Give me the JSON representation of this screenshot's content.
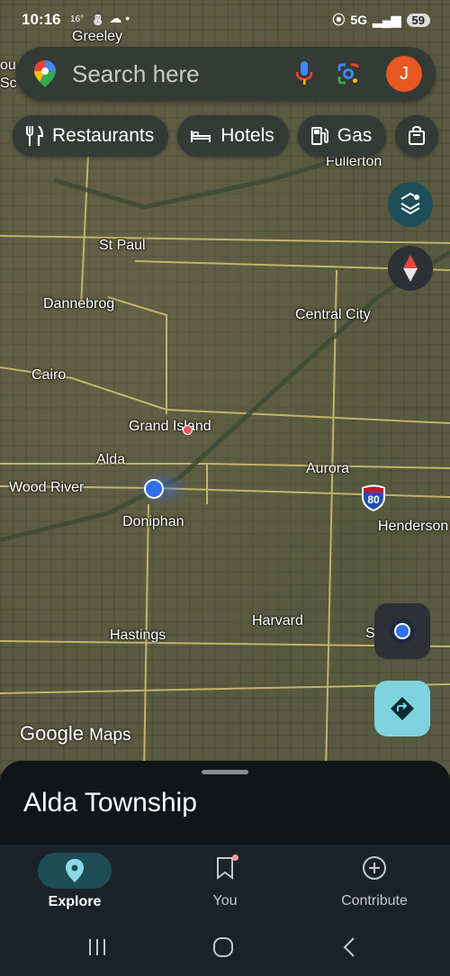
{
  "status_bar": {
    "time": "10:16",
    "temp": "16°",
    "weather": "⛄ ☁ •",
    "network": "5G",
    "battery": "59"
  },
  "search": {
    "placeholder": "Search here",
    "avatar_letter": "J"
  },
  "chips": [
    {
      "label": "Restaurants",
      "icon": "fork-knife-icon"
    },
    {
      "label": "Hotels",
      "icon": "bed-icon"
    },
    {
      "label": "Gas",
      "icon": "gas-pump-icon"
    },
    {
      "label": "",
      "icon": "shopping-bag-icon"
    }
  ],
  "map": {
    "places": [
      {
        "name": "Greeley"
      },
      {
        "name": "Fullerton"
      },
      {
        "name": "St Paul"
      },
      {
        "name": "Dannebrog"
      },
      {
        "name": "Central City"
      },
      {
        "name": "Cairo"
      },
      {
        "name": "Grand Island"
      },
      {
        "name": "Alda"
      },
      {
        "name": "Aurora"
      },
      {
        "name": "Wood River"
      },
      {
        "name": "Doniphan"
      },
      {
        "name": "Henderson"
      },
      {
        "name": "Harvard"
      },
      {
        "name": "Hastings"
      },
      {
        "name": "S"
      },
      {
        "name": "ou"
      },
      {
        "name": "Sc"
      }
    ],
    "interstate": "80",
    "attribution_brand": "Google",
    "attribution_product": "Maps"
  },
  "sheet": {
    "title": "Alda Township"
  },
  "bottom_nav": [
    {
      "label": "Explore",
      "active": true
    },
    {
      "label": "You",
      "active": false
    },
    {
      "label": "Contribute",
      "active": false
    }
  ],
  "colors": {
    "accent": "#7fd3de",
    "avatar": "#e8571f",
    "sheet": "#121518",
    "nav": "#1b2227",
    "road": "#c8b86a"
  }
}
